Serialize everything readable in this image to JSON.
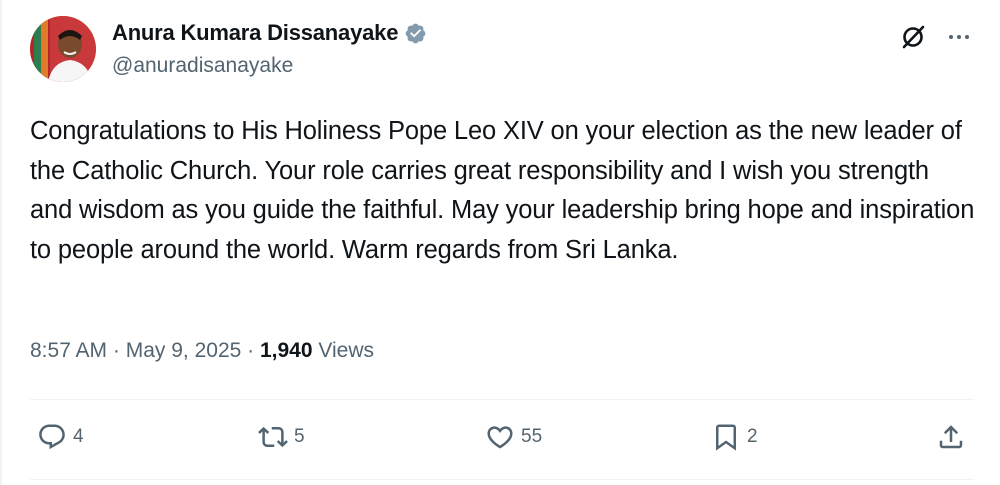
{
  "author": {
    "display_name": "Anura Kumara Dissanayake",
    "handle": "@anuradisanayake",
    "verified": true
  },
  "tweet": {
    "text": "Congratulations to His Holiness Pope Leo XIV on your election as the new leader of the Catholic Church. Your role carries great responsibility and I wish you strength and wisdom as you guide the faithful. May your leadership bring hope and inspiration to people around the world. Warm regards from Sri Lanka."
  },
  "meta": {
    "time": "8:57 AM",
    "separator": " · ",
    "date": "May 9, 2025",
    "views_count": "1,940",
    "views_label": "Views"
  },
  "actions": {
    "replies": "4",
    "reposts": "5",
    "likes": "55",
    "bookmarks": "2"
  },
  "icons": {
    "header": [
      "grok-icon",
      "more-icon"
    ],
    "actions": [
      "reply-icon",
      "repost-icon",
      "like-icon",
      "bookmark-icon",
      "share-icon"
    ]
  },
  "colors": {
    "text": "#0f1419",
    "secondary": "#536471",
    "verified_badge": "#829aab",
    "divider": "#eff3f4"
  }
}
